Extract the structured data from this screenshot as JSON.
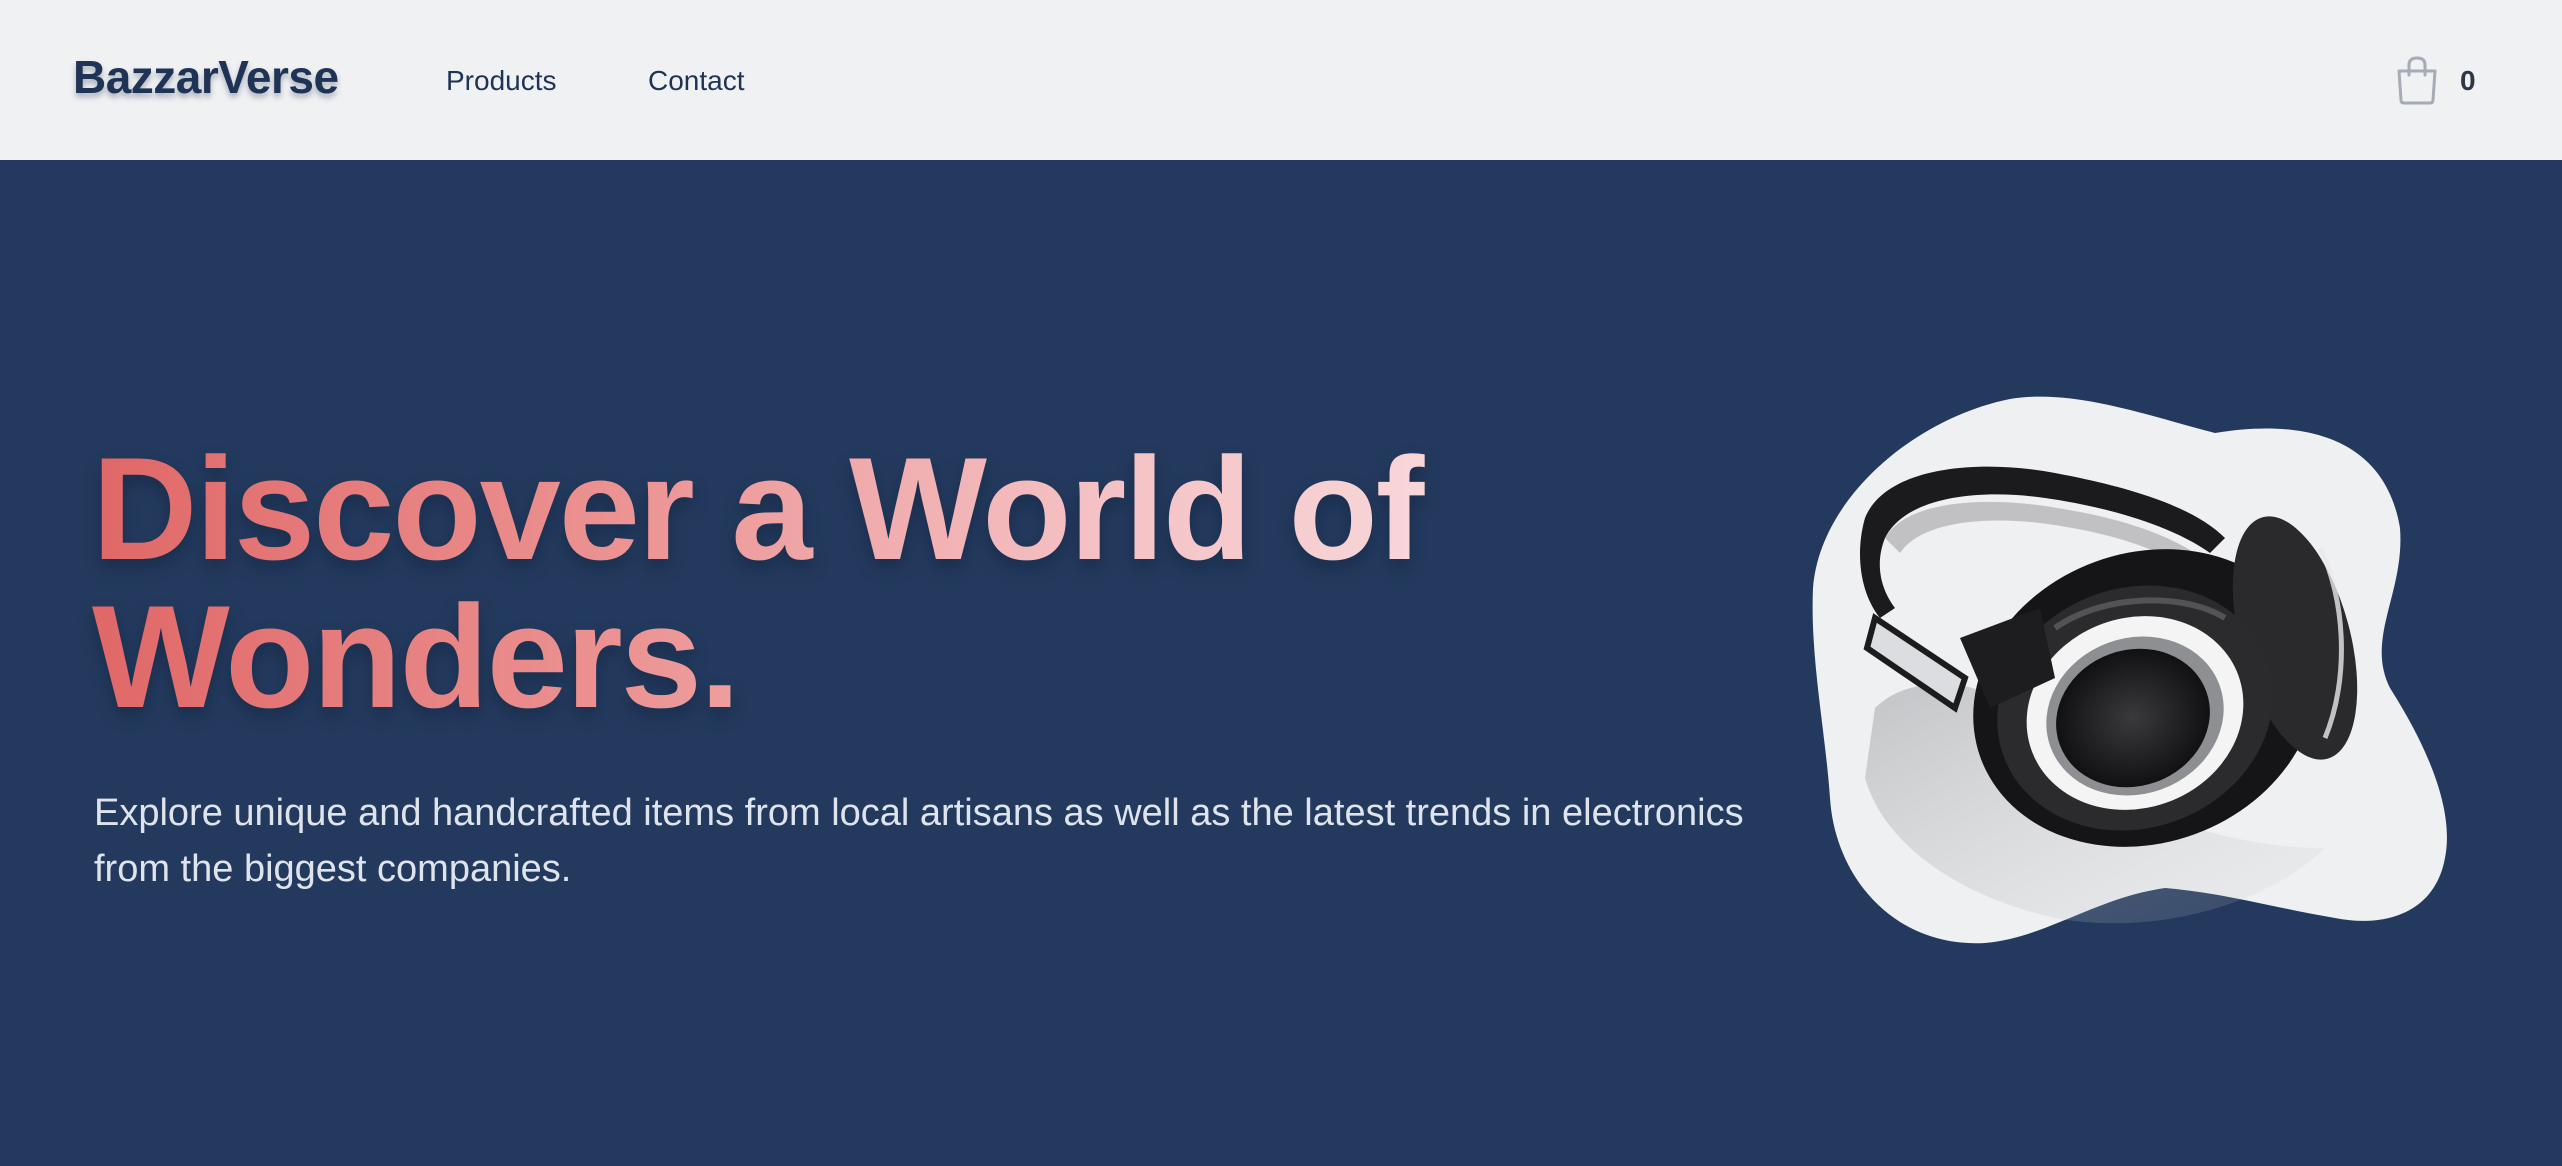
{
  "brand": {
    "name": "BazzarVerse"
  },
  "nav": {
    "items": [
      {
        "label": "Products"
      },
      {
        "label": "Contact"
      }
    ]
  },
  "cart": {
    "icon": "shopping-bag-icon",
    "count": "0"
  },
  "hero": {
    "headline": "Discover a World of Wonders.",
    "subtext": "Explore unique and handcrafted items from local artisans as well as the latest trends in electronics from the biggest companies.",
    "image": "headphones-illustration"
  },
  "colors": {
    "navbar_bg": "#f0f1f3",
    "hero_bg": "#233a5e",
    "brand_text": "#1f3356",
    "headline_gradient": [
      "#e06767",
      "#fae2e4"
    ],
    "subtext": "#dfe4ec"
  }
}
